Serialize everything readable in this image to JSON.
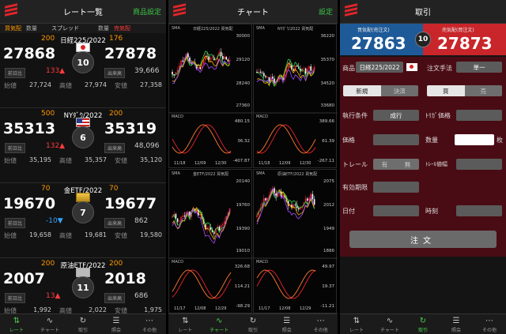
{
  "rate_list": {
    "title": "レート一覧",
    "settings": "商品設定",
    "labels": {
      "sell": "買気配",
      "qty": "数量",
      "spread": "スプレッド",
      "qty2": "数量",
      "buy": "売気配"
    },
    "instruments": [
      {
        "name": "日経225/2022",
        "left_sp": "200",
        "right_sp": "176",
        "bid": "27868",
        "ask": "27878",
        "spread": "10",
        "flag": "jp",
        "change_tag": "前日比",
        "change": "133▲",
        "change_color": "red",
        "vol_tag": "出来高",
        "volume": "39,666",
        "stats": [
          [
            "始値",
            "27,724"
          ],
          [
            "高値",
            "27,974"
          ],
          [
            "安値",
            "27,358"
          ]
        ]
      },
      {
        "name": "NYﾀﾞｳ/2022",
        "left_sp": "500",
        "right_sp": "200",
        "bid": "35313",
        "ask": "35319",
        "spread": "6",
        "flag": "us",
        "change_tag": "前日比",
        "change": "132▲",
        "change_color": "red",
        "vol_tag": "出来高",
        "volume": "48,096",
        "stats": [
          [
            "始値",
            "35,195"
          ],
          [
            "高値",
            "35,357"
          ],
          [
            "安値",
            "35,120"
          ]
        ]
      },
      {
        "name": "金ETF/2022",
        "left_sp": "70",
        "right_sp": "70",
        "bid": "19670",
        "ask": "19677",
        "spread": "7",
        "flag": "gold",
        "change_tag": "前日比",
        "change": "-10▼",
        "change_color": "blue",
        "vol_tag": "出来高",
        "volume": "862",
        "stats": [
          [
            "始値",
            "19,658"
          ],
          [
            "高値",
            "19,681"
          ],
          [
            "安値",
            "19,580"
          ]
        ]
      },
      {
        "name": "原油ETF/2022",
        "left_sp": "200",
        "right_sp": "200",
        "bid": "2007",
        "ask": "2018",
        "spread": "11",
        "flag": "oil",
        "change_tag": "前日比",
        "change": "13▲",
        "change_color": "red",
        "vol_tag": "出来高",
        "volume": "686",
        "stats": [
          [
            "始値",
            "1,992"
          ],
          [
            "高値",
            "2,022"
          ],
          [
            "安値",
            "1,975"
          ]
        ]
      }
    ]
  },
  "chart": {
    "title": "チャート",
    "settings": "設定",
    "boxes": [
      {
        "id": "c1",
        "label": "SMA",
        "sub": "日経225/2022  買気配",
        "ticks": [
          "30000",
          "29120",
          "28240",
          "27360"
        ],
        "macd": "MACD",
        "macd_ticks": [
          "480.15",
          "36.32",
          "-407.87"
        ],
        "dates": [
          "11/18",
          "12/09",
          "12/30"
        ]
      },
      {
        "id": "c2",
        "label": "SMA",
        "sub": "NYﾀﾞｳ/2022  買気配",
        "ticks": [
          "36220",
          "35370",
          "34520",
          "33680"
        ],
        "macd": "MACD",
        "macd_ticks": [
          "389.66",
          "61.39",
          "-267.11"
        ],
        "dates": [
          "11/18",
          "12/09",
          "12/30"
        ]
      },
      {
        "id": "c3",
        "label": "SMA",
        "sub": "金ETF/2022  買気配",
        "ticks": [
          "20140",
          "19760",
          "19390",
          "19010"
        ],
        "macd": "MACD",
        "macd_ticks": [
          "326.68",
          "114.21",
          "-98.29"
        ],
        "dates": [
          "11/17",
          "12/08",
          "12/29"
        ]
      },
      {
        "id": "c4",
        "label": "SMA",
        "sub": "原油ETF/2022  買気配",
        "ticks": [
          "2075",
          "2012",
          "1949",
          "1886"
        ],
        "macd": "MACD",
        "macd_ticks": [
          "49.97",
          "19.37",
          "-11.21"
        ],
        "dates": [
          "11/17",
          "12/08",
          "12/29"
        ]
      }
    ]
  },
  "trade": {
    "title": "取引",
    "sell_label": "買気配(売注文)",
    "buy_label": "売気配(買注文)",
    "sell_value": "27863",
    "buy_value": "27873",
    "spread": "10",
    "product_label": "商品",
    "product_value": "日経225/2022",
    "method_label": "注文手法",
    "method_value": "単一",
    "new_label": "新規",
    "settle_label": "決済",
    "buy_tab": "買",
    "sell_tab": "売",
    "cond_label": "執行条件",
    "cond_value": "成行",
    "trigger_label": "ﾄﾘｶﾞ価格",
    "price_label": "価格",
    "qty_label": "数量",
    "qty_unit": "枚",
    "trail_label": "トレール",
    "trail_on": "有",
    "trail_off": "無",
    "trail_width": "ﾄﾚｰﾙ値幅",
    "expiry_label": "有効期限",
    "date_label": "日付",
    "time_label": "時刻",
    "order_button": "注文"
  },
  "nav": [
    {
      "label": "レート",
      "icon": "⇅"
    },
    {
      "label": "チャート",
      "icon": "∿"
    },
    {
      "label": "取引",
      "icon": "↻"
    },
    {
      "label": "照会",
      "icon": "☰"
    },
    {
      "label": "その他",
      "icon": "⋯"
    }
  ],
  "colors": {
    "accent_green": "#3cc447",
    "up_red": "#ff3b3b",
    "down_blue": "#33a6ff",
    "spread_orange": "#ff9900",
    "sell_blue": "#1e5a98",
    "buy_red": "#c8262a",
    "maroon": "#4a0c14"
  }
}
